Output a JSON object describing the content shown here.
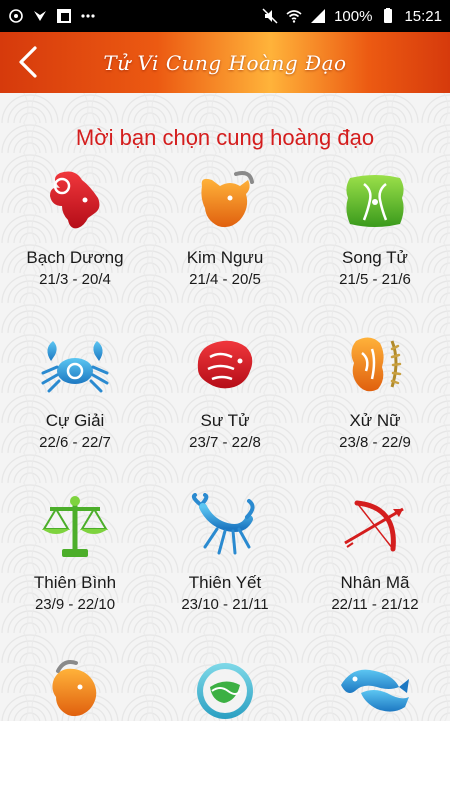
{
  "status_bar": {
    "battery": "100%",
    "time": "15:21"
  },
  "app_bar": {
    "title": "Tử Vi Cung Hoàng Đạo",
    "back_icon": "chevron-left-icon"
  },
  "heading": "Mời bạn chọn cung hoàng đạo",
  "colors": {
    "heading": "#d41d1d",
    "app_bar_primary": "#ec5a12",
    "app_bar_highlight": "#ffb33a"
  },
  "signs": [
    {
      "name": "Bạch Dương",
      "date": "21/3 - 20/4",
      "icon": "aries-ram-icon"
    },
    {
      "name": "Kim Ngưu",
      "date": "21/4 - 20/5",
      "icon": "taurus-bull-icon"
    },
    {
      "name": "Song Tử",
      "date": "21/5 - 21/6",
      "icon": "gemini-twins-icon"
    },
    {
      "name": "Cự Giải",
      "date": "22/6 - 22/7",
      "icon": "cancer-crab-icon"
    },
    {
      "name": "Sư Tử",
      "date": "23/7 - 22/8",
      "icon": "leo-lion-icon"
    },
    {
      "name": "Xử Nữ",
      "date": "23/8 - 22/9",
      "icon": "virgo-maiden-icon"
    },
    {
      "name": "Thiên Bình",
      "date": "23/9 - 22/10",
      "icon": "libra-scales-icon"
    },
    {
      "name": "Thiên Yết",
      "date": "23/10 - 21/11",
      "icon": "scorpio-scorpion-icon"
    },
    {
      "name": "Nhân Mã",
      "date": "22/11 - 21/12",
      "icon": "sagittarius-bow-icon"
    },
    {
      "name": "",
      "date": "",
      "icon": "capricorn-goat-icon"
    },
    {
      "name": "",
      "date": "",
      "icon": "aquarius-water-icon"
    },
    {
      "name": "",
      "date": "",
      "icon": "pisces-fish-icon"
    }
  ]
}
